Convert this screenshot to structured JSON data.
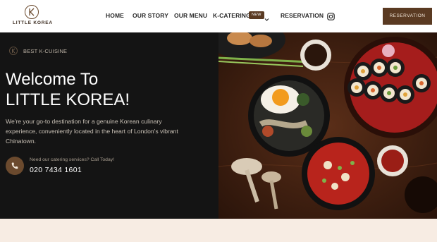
{
  "brand": {
    "name": "LITTLE KOREA"
  },
  "nav": {
    "items": [
      {
        "label": "HOME"
      },
      {
        "label": "OUR STORY"
      },
      {
        "label": "OUR MENU"
      },
      {
        "label": "K-CATERING",
        "badge": "NEW"
      },
      {
        "label": "RESERVATION"
      }
    ],
    "social_icon": "instagram-icon",
    "cta_label": "RESERVATION"
  },
  "hero": {
    "kicker": "BEST K-CUISINE",
    "title_line1": "Welcome To",
    "title_line2": "LITTLE KOREA!",
    "description": "We're your go-to destination for a genuine Korean culinary experience, conveniently located in the heart of London's vibrant Chinatown.",
    "call_label": "Need our catering services? Call Today!",
    "phone": "020 7434 1601",
    "call_icon": "phone-icon"
  },
  "colors": {
    "brand_brown": "#5a3a22",
    "hero_bg": "#141414",
    "band_bg": "#f7ece3"
  }
}
